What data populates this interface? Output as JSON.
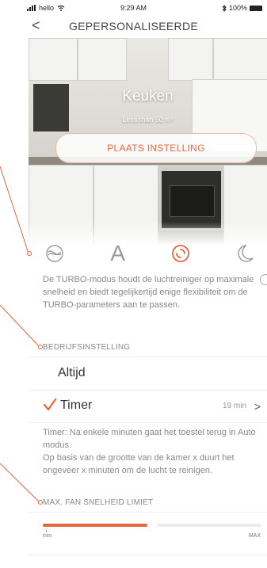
{
  "status_bar": {
    "carrier": "hello",
    "time": "9:29 AM",
    "battery": "100%"
  },
  "nav": {
    "back_label": "<",
    "title": "GEPERSONALISEERDE"
  },
  "hero": {
    "room": "Keuken",
    "size": "Less than 50 m²",
    "button_label": "PLAATS INSTELLING"
  },
  "modes": [
    {
      "icon": "silent-mode-icon",
      "active": false
    },
    {
      "icon": "auto-mode-icon",
      "label": "A",
      "active": false
    },
    {
      "icon": "turbo-mode-icon",
      "active": true
    },
    {
      "icon": "night-mode-icon",
      "active": false
    }
  ],
  "description": "De TURBO-modus houdt de luchtreiniger op maximale snelheid en biedt tegelijkertijd enige flexibiliteit om de TURBO-parameters aan te passen.",
  "operation": {
    "label": "BEDRIJFSINSTELLING",
    "value": "Altijd"
  },
  "timer": {
    "label": "Timer",
    "value": "19 min",
    "chevron": ">",
    "description_1": "Timer: Na enkele minuten gaat het toestel terug in Auto modus.",
    "description_2": "Op basis van de grootte van de kamer x duurt het ongeveer x minuten om de lucht te reinigen."
  },
  "fan_limit": {
    "label": "MAX. FAN SNELHEID LIMIET",
    "min_label": "min",
    "max_label": "MAX",
    "level": 0.48
  },
  "colors": {
    "accent": "#e8663d",
    "text": "#333333",
    "muted": "#888888"
  }
}
